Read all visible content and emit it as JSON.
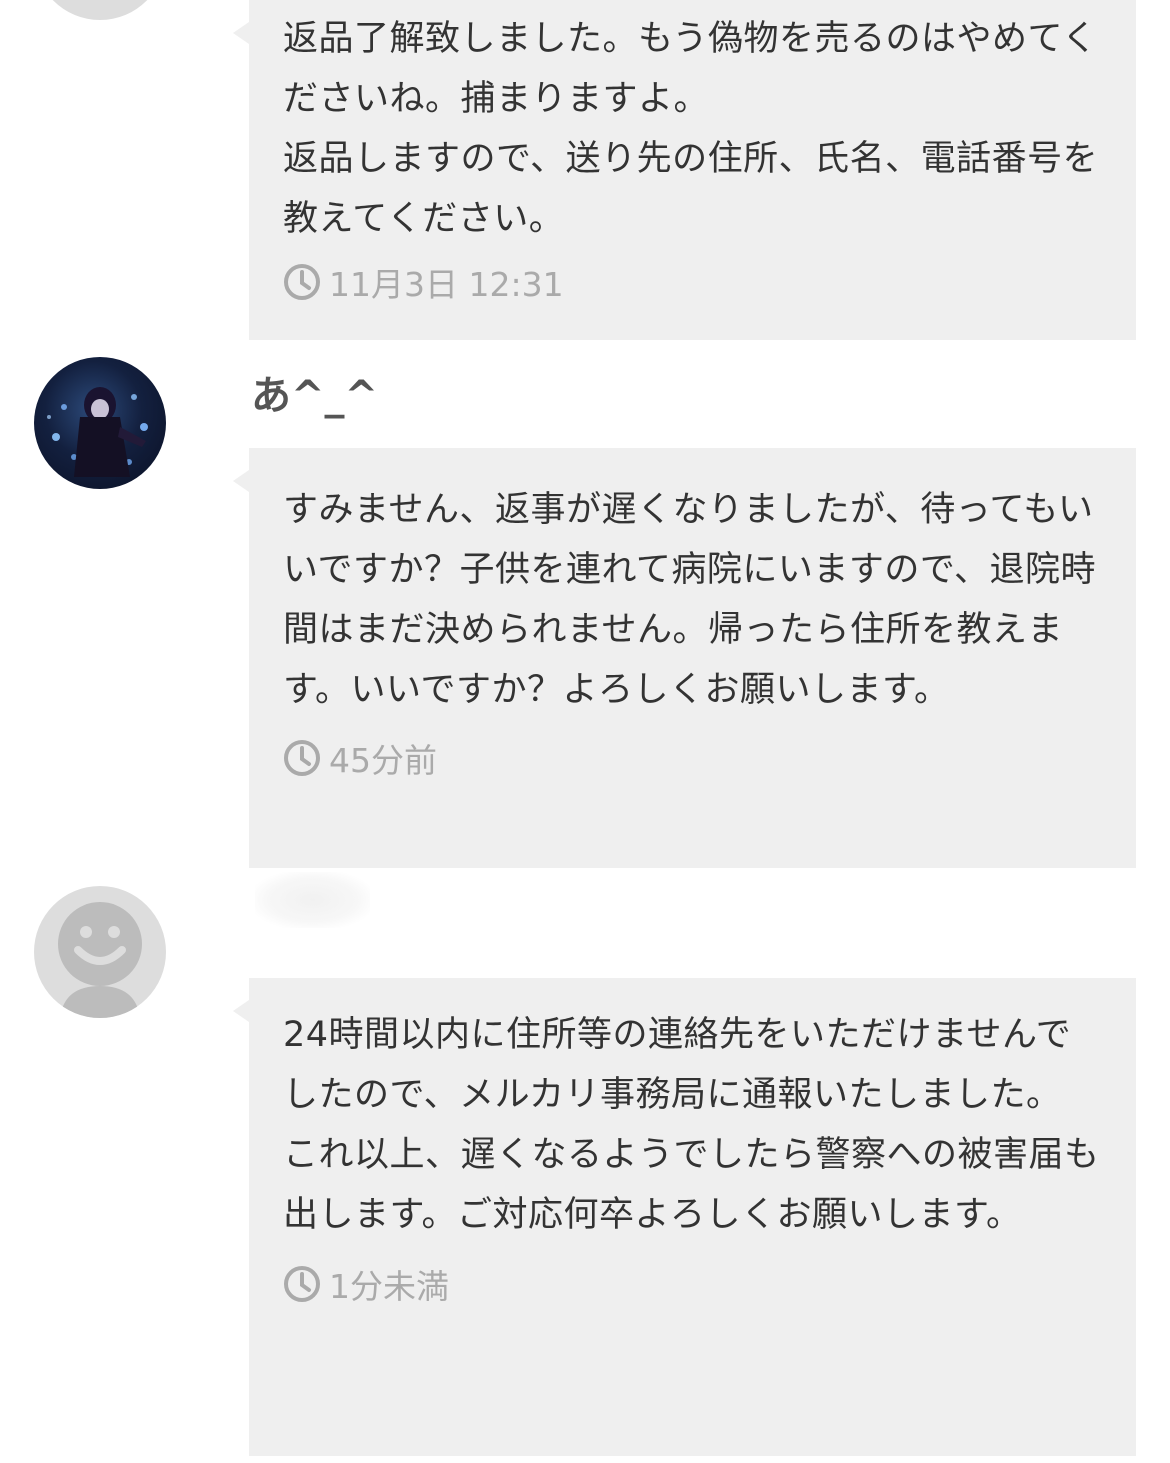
{
  "messages": [
    {
      "sender": "",
      "avatar": "default-user-avatar",
      "text": "返品了解致しました。もう偽物を売るのはやめてくださいね。捕まりますよ。\n返品しますので、送り先の住所、氏名、電話番号を教えてください。",
      "time": "11月3日 12:31"
    },
    {
      "sender": "あ^_^",
      "avatar": "anime-character-avatar",
      "text": "すみません、返事が遅くなりましたが、待ってもいいですか？子供を連れて病院にいますので、退院時間はまだ決められません。帰ったら住所を教えます。いいですか？よろしくお願いします。",
      "time": "45分前"
    },
    {
      "sender": "",
      "avatar": "default-user-avatar",
      "text": "24時間以内に住所等の連絡先をいただけませんでしたので、メルカリ事務局に通報いたしました。\nこれ以上、遅くなるようでしたら警察への被害届も出します。ご対応何卒よろしくお願いします。",
      "time": "1分未満"
    }
  ],
  "colors": {
    "bubble": "#efefef",
    "text": "#333333",
    "time": "#aaaaaa",
    "avatar_default": "#dddddd"
  },
  "icons": {
    "time": "clock-icon"
  }
}
